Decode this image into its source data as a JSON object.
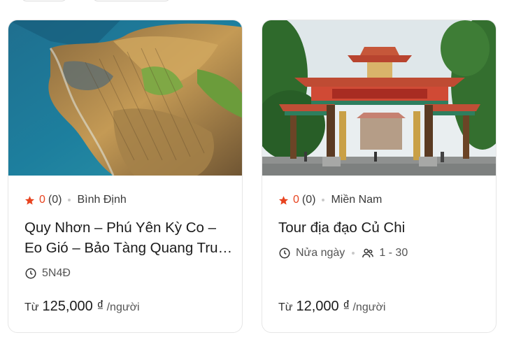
{
  "cards": [
    {
      "rating": "0",
      "reviews": "(0)",
      "location": "Bình Định",
      "title": "Quy Nhơn – Phú Yên Kỳ Co – Eo Gió – Bảo Tàng Quang Trung – Tháp Đôi",
      "duration": "5N4Đ",
      "price_prefix": "Từ",
      "price": "125,000 ₫",
      "price_unit": "/người",
      "image": "aerial-coastal-rock-columns"
    },
    {
      "rating": "0",
      "reviews": "(0)",
      "location": "Miền Nam",
      "title": "Tour địa đạo Củ Chi",
      "duration": "Nửa ngày",
      "group_size": "1 - 30",
      "price_prefix": "Từ",
      "price": "12,000 ₫",
      "price_unit": "/người",
      "image": "temple-gate"
    }
  ],
  "colors": {
    "star": "#e8431f",
    "rating": "#e8431f",
    "border": "#e6e6e6"
  }
}
